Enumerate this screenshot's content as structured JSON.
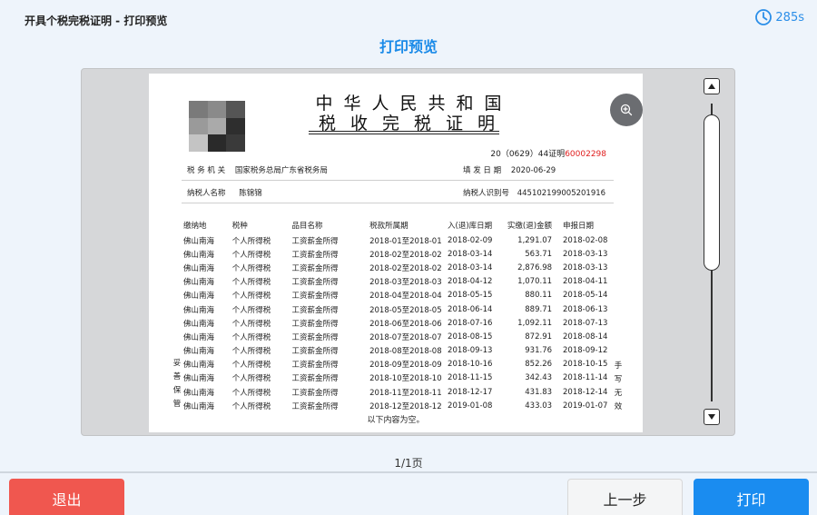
{
  "app": {
    "title": "开具个税完税证明 - 打印预览",
    "timer_label": "285s",
    "timer_icon": "clock-icon",
    "page_heading": "打印预览"
  },
  "certificate": {
    "title_line1": "中华人民共和国",
    "title_line2": "税收完税证明",
    "cert_no_prefix": "20（0629）44证明",
    "cert_no_red": "60002298",
    "tax_office_label": "税 务 机 关",
    "tax_office_value": "国家税务总局广东省税务局",
    "fill_date_label": "填 发 日 期",
    "fill_date_value": "2020-06-29",
    "taxpayer_name_label": "纳税人名称",
    "taxpayer_name_value": "陈锦锦",
    "taxpayer_id_label": "纳税人识别号",
    "taxpayer_id_value": "445102199005201916",
    "columns": [
      "缴纳地",
      "税种",
      "品目名称",
      "税款所属期",
      "入(退)库日期",
      "实缴(退)金额",
      "申报日期"
    ],
    "rows": [
      [
        "佛山南海",
        "个人所得税",
        "工资薪金所得",
        "2018-01至2018-01",
        "2018-02-09",
        "1,291.07",
        "2018-02-08"
      ],
      [
        "佛山南海",
        "个人所得税",
        "工资薪金所得",
        "2018-02至2018-02",
        "2018-03-14",
        "563.71",
        "2018-03-13"
      ],
      [
        "佛山南海",
        "个人所得税",
        "工资薪金所得",
        "2018-02至2018-02",
        "2018-03-14",
        "2,876.98",
        "2018-03-13"
      ],
      [
        "佛山南海",
        "个人所得税",
        "工资薪金所得",
        "2018-03至2018-03",
        "2018-04-12",
        "1,070.11",
        "2018-04-11"
      ],
      [
        "佛山南海",
        "个人所得税",
        "工资薪金所得",
        "2018-04至2018-04",
        "2018-05-15",
        "880.11",
        "2018-05-14"
      ],
      [
        "佛山南海",
        "个人所得税",
        "工资薪金所得",
        "2018-05至2018-05",
        "2018-06-14",
        "889.71",
        "2018-06-13"
      ],
      [
        "佛山南海",
        "个人所得税",
        "工资薪金所得",
        "2018-06至2018-06",
        "2018-07-16",
        "1,092.11",
        "2018-07-13"
      ],
      [
        "佛山南海",
        "个人所得税",
        "工资薪金所得",
        "2018-07至2018-07",
        "2018-08-15",
        "872.91",
        "2018-08-14"
      ],
      [
        "佛山南海",
        "个人所得税",
        "工资薪金所得",
        "2018-08至2018-08",
        "2018-09-13",
        "931.76",
        "2018-09-12"
      ],
      [
        "佛山南海",
        "个人所得税",
        "工资薪金所得",
        "2018-09至2018-09",
        "2018-10-16",
        "852.26",
        "2018-10-15"
      ],
      [
        "佛山南海",
        "个人所得税",
        "工资薪金所得",
        "2018-10至2018-10",
        "2018-11-15",
        "342.43",
        "2018-11-14"
      ],
      [
        "佛山南海",
        "个人所得税",
        "工资薪金所得",
        "2018-11至2018-11",
        "2018-12-17",
        "431.83",
        "2018-12-14"
      ],
      [
        "佛山南海",
        "个人所得税",
        "工资薪金所得",
        "2018-12至2018-12",
        "2019-01-08",
        "433.03",
        "2019-01-07"
      ]
    ],
    "footnote": "以下内容为空。",
    "side_left": "妥善保管",
    "side_right": "手写无效"
  },
  "viewer": {
    "zoom_in_icon": "zoom-in-icon",
    "zoom_out_icon": "zoom-out-icon",
    "page_count": "1/1页"
  },
  "buttons": {
    "exit": "退出",
    "prev": "上一步",
    "print": "打印"
  },
  "colors": {
    "accent": "#1a8cf0",
    "exit": "#f0574f",
    "cert_no_red": "#e02020"
  }
}
